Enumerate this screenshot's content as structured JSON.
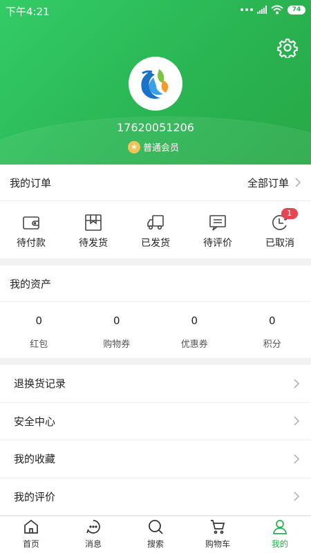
{
  "status_bar": {
    "time": "下午4:21",
    "battery": "74"
  },
  "profile": {
    "phone": "17620051206",
    "member_level": "普通会员"
  },
  "orders": {
    "title": "我的订单",
    "all_orders": "全部订单",
    "items": [
      {
        "label": "待付款",
        "icon": "wallet-icon"
      },
      {
        "label": "待发货",
        "icon": "box-icon"
      },
      {
        "label": "已发货",
        "icon": "truck-icon"
      },
      {
        "label": "待评价",
        "icon": "comment-icon"
      },
      {
        "label": "已取消",
        "icon": "clock-icon",
        "badge": "1"
      }
    ]
  },
  "assets": {
    "title": "我的资产",
    "items": [
      {
        "value": "0",
        "label": "红包"
      },
      {
        "value": "0",
        "label": "购物券"
      },
      {
        "value": "0",
        "label": "优惠券"
      },
      {
        "value": "0",
        "label": "积分"
      }
    ]
  },
  "menu": [
    {
      "label": "退换货记录"
    },
    {
      "label": "安全中心"
    },
    {
      "label": "我的收藏"
    },
    {
      "label": "我的评价"
    }
  ],
  "tabs": [
    {
      "label": "首页",
      "icon": "home-icon"
    },
    {
      "label": "消息",
      "icon": "message-icon"
    },
    {
      "label": "搜索",
      "icon": "search-icon"
    },
    {
      "label": "购物车",
      "icon": "cart-icon"
    },
    {
      "label": "我的",
      "icon": "user-icon",
      "active": true
    }
  ],
  "colors": {
    "brand_green": "#27b04d",
    "badge_red": "#e64552",
    "member_gold": "#f3c25a"
  }
}
